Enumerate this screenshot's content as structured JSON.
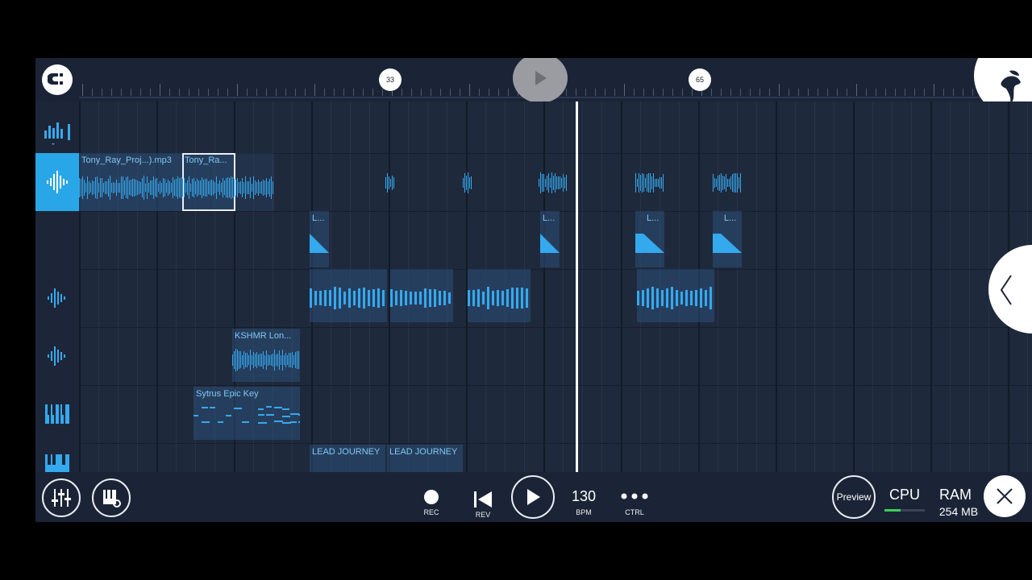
{
  "ruler": {
    "markers": [
      "33",
      "65"
    ]
  },
  "tracks": [
    {
      "icon": "level-meter-icon"
    },
    {
      "icon": "audio-waveform-icon"
    },
    {
      "icon": "automation-icon"
    },
    {
      "icon": "audio-waveform-icon"
    },
    {
      "icon": "audio-waveform-icon"
    },
    {
      "icon": "piano-keys-icon"
    },
    {
      "icon": "piano-keys-icon"
    }
  ],
  "clips": {
    "tony_ray_mp3": "Tony_Ray_Proj...).mp3",
    "tony_ray_short": "Tony_Ra...",
    "auto_l": "L...",
    "kshmr": "KSHMR Lon...",
    "sytrus": "Sytrus Epic Key",
    "lead_journey": "LEAD JOURNEY"
  },
  "toolbar": {
    "rec": "REC",
    "rev": "REV",
    "bpm_value": "130",
    "bpm_label": "BPM",
    "ctrl": "CTRL",
    "preview": "Preview",
    "cpu": "CPU",
    "ram_label": "RAM",
    "ram_value": "254 MB"
  },
  "colors": {
    "accent": "#29a6e8",
    "background": "#1b2436",
    "clip": "#2b5078"
  }
}
